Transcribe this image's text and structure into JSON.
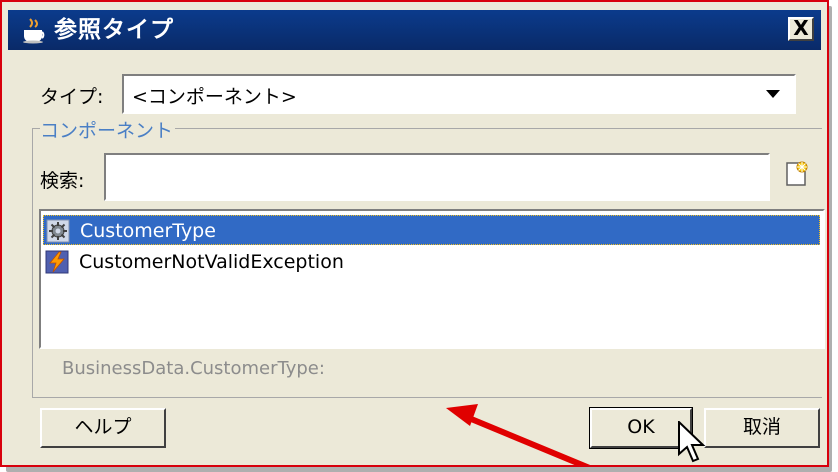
{
  "title_bar": {
    "title": "参照タイプ",
    "close_label": "X"
  },
  "type_row": {
    "label": "タイプ:",
    "value": "<コンポーネント>"
  },
  "component_group": {
    "title": "コンポーネント"
  },
  "search": {
    "label": "検索:",
    "value": ""
  },
  "list": {
    "items": [
      {
        "label": "CustomerType",
        "icon": "gear-type-icon",
        "selected": true
      },
      {
        "label": "CustomerNotValidException",
        "icon": "lightning-exception-icon",
        "selected": false
      }
    ]
  },
  "status": {
    "text": "BusinessData.CustomerType:"
  },
  "buttons": {
    "help": "ヘルプ",
    "ok": "OK",
    "cancel": "取消"
  },
  "colors": {
    "title_bar": "#0a2a68",
    "selection": "#316ac5",
    "annotation_arrow": "#e00000",
    "dialog_border": "#d8000c"
  }
}
